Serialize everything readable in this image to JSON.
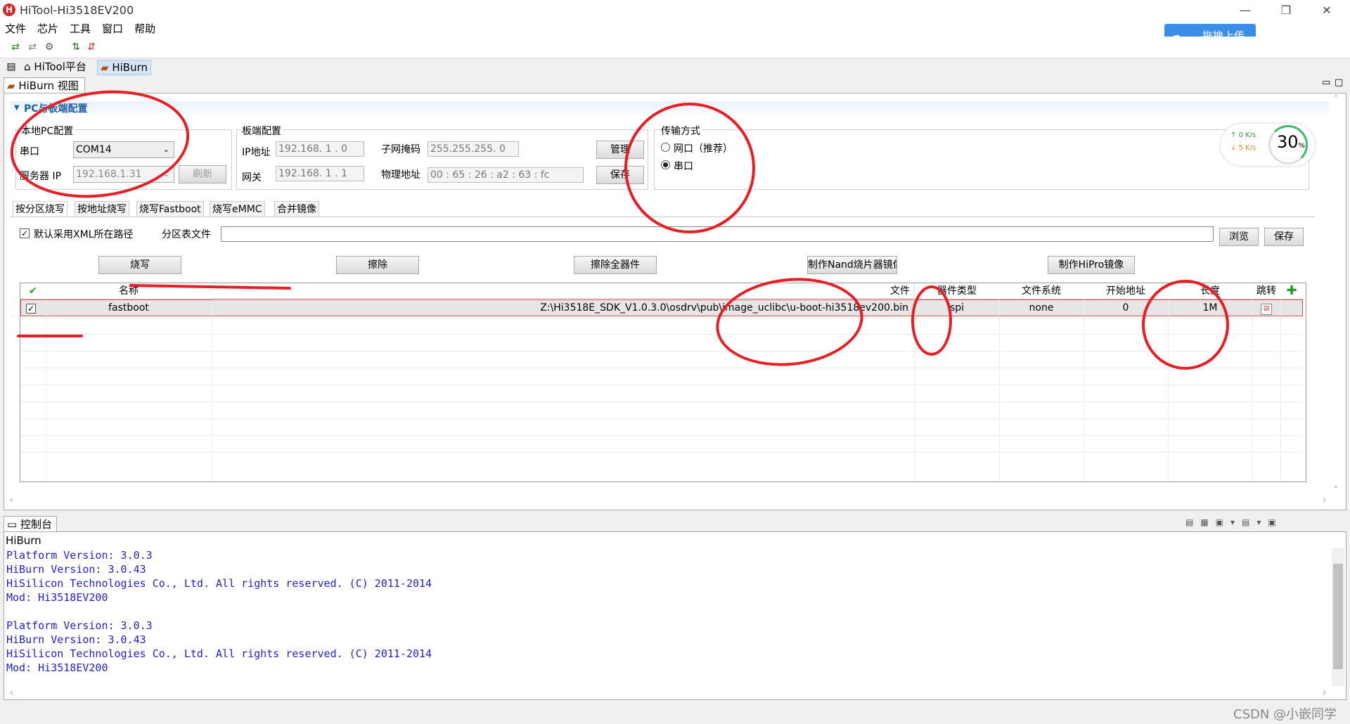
{
  "window": {
    "title": "HiTool-Hi3518EV200"
  },
  "menu": [
    "文件",
    "芯片",
    "工具",
    "窗口",
    "帮助"
  ],
  "upload_button": {
    "label": "拖拽上传"
  },
  "perspectives": [
    {
      "label": "HiTool平台",
      "icon": "home-icon"
    },
    {
      "label": "HiBurn",
      "icon": "burn-icon"
    }
  ],
  "view": {
    "tab_label": "HiBurn 视图"
  },
  "section": {
    "title": "PC与板端配置"
  },
  "local_pc": {
    "group_label": "本地PC配置",
    "port_label": "串口",
    "port_value": "COM14",
    "server_ip_label": "服务器 IP",
    "server_ip_value": "192.168.1.31",
    "refresh_label": "刷新"
  },
  "board": {
    "group_label": "板端配置",
    "ip_label": "IP地址",
    "ip_value": "192.168.  1  . 0",
    "mask_label": "子网掩码",
    "mask_value": "255.255.255. 0",
    "gateway_label": "网关",
    "gateway_value": "192.168.  1  . 1",
    "mac_label": "物理地址",
    "mac_value": "00  :  65  :  26  :  a2  :  63  :  fc",
    "manage_label": "管理",
    "save_label": "保存"
  },
  "transfer": {
    "group_label": "传输方式",
    "net_label": "网口（推荐）",
    "serial_label": "串口",
    "selected": "串口"
  },
  "speed": {
    "up": "0  K/s",
    "down": "5  K/s",
    "percent": "30",
    "unit": "%"
  },
  "tabs": [
    "按分区烧写",
    "按地址烧写",
    "烧写Fastboot",
    "烧写eMMC",
    "合并镜像"
  ],
  "options": {
    "xml_label": "默认采用XML所在路径",
    "xml_checked": true,
    "partition_label": "分区表文件",
    "partition_value": "",
    "browse_label": "浏览",
    "save_label": "保存"
  },
  "actions": [
    "烧写",
    "擦除",
    "擦除全器件",
    "制作Nand烧片器镜像",
    "制作HiPro镜像"
  ],
  "table": {
    "headers": [
      "名称",
      "文件",
      "器件类型",
      "文件系统",
      "开始地址",
      "长度",
      "跳转"
    ],
    "rows": [
      {
        "checked": true,
        "name": "fastboot",
        "file": "Z:\\Hi3518E_SDK_V1.0.3.0\\osdrv\\pub\\image_uclibc\\u-boot-hi3518ev200.bin",
        "device": "spi",
        "fs": "none",
        "start": "0",
        "length": "1M"
      }
    ]
  },
  "console": {
    "tab_label": "控制台",
    "title": "HiBurn",
    "lines": [
      "Platform Version: 3.0.3",
      "HiBurn Version: 3.0.43",
      "HiSilicon Technologies Co., Ltd. All rights reserved. (C) 2011-2014",
      "Mod: Hi3518EV200",
      "",
      "Platform Version: 3.0.3",
      "HiBurn Version: 3.0.43",
      "HiSilicon Technologies Co., Ltd. All rights reserved. (C) 2011-2014",
      "Mod: Hi3518EV200"
    ]
  },
  "watermark": "CSDN @小嵌同学"
}
